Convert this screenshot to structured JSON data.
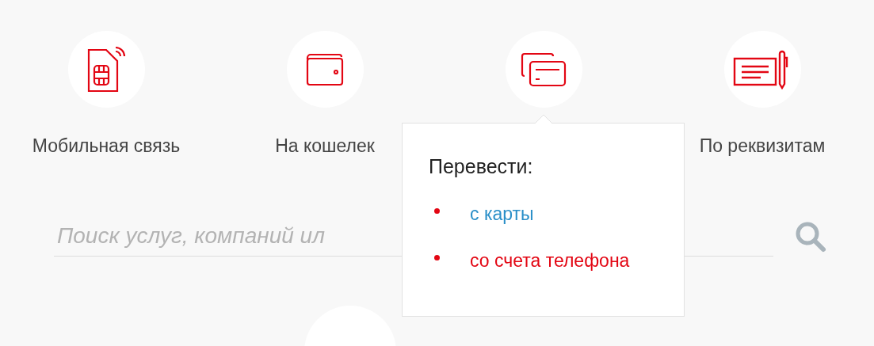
{
  "services": [
    {
      "kind": "sim",
      "label": "Мобильная связь"
    },
    {
      "kind": "wallet",
      "label": "На кошелек"
    },
    {
      "kind": "cards"
    },
    {
      "kind": "form",
      "label": "По реквизитам"
    }
  ],
  "popover": {
    "title": "Перевести:",
    "links": [
      {
        "label": "с карты",
        "color": "#2a8fc8"
      },
      {
        "label": "со счета телефона",
        "color": "#e30613"
      }
    ]
  },
  "search": {
    "placeholder": "Поиск услуг, компаний ил"
  }
}
